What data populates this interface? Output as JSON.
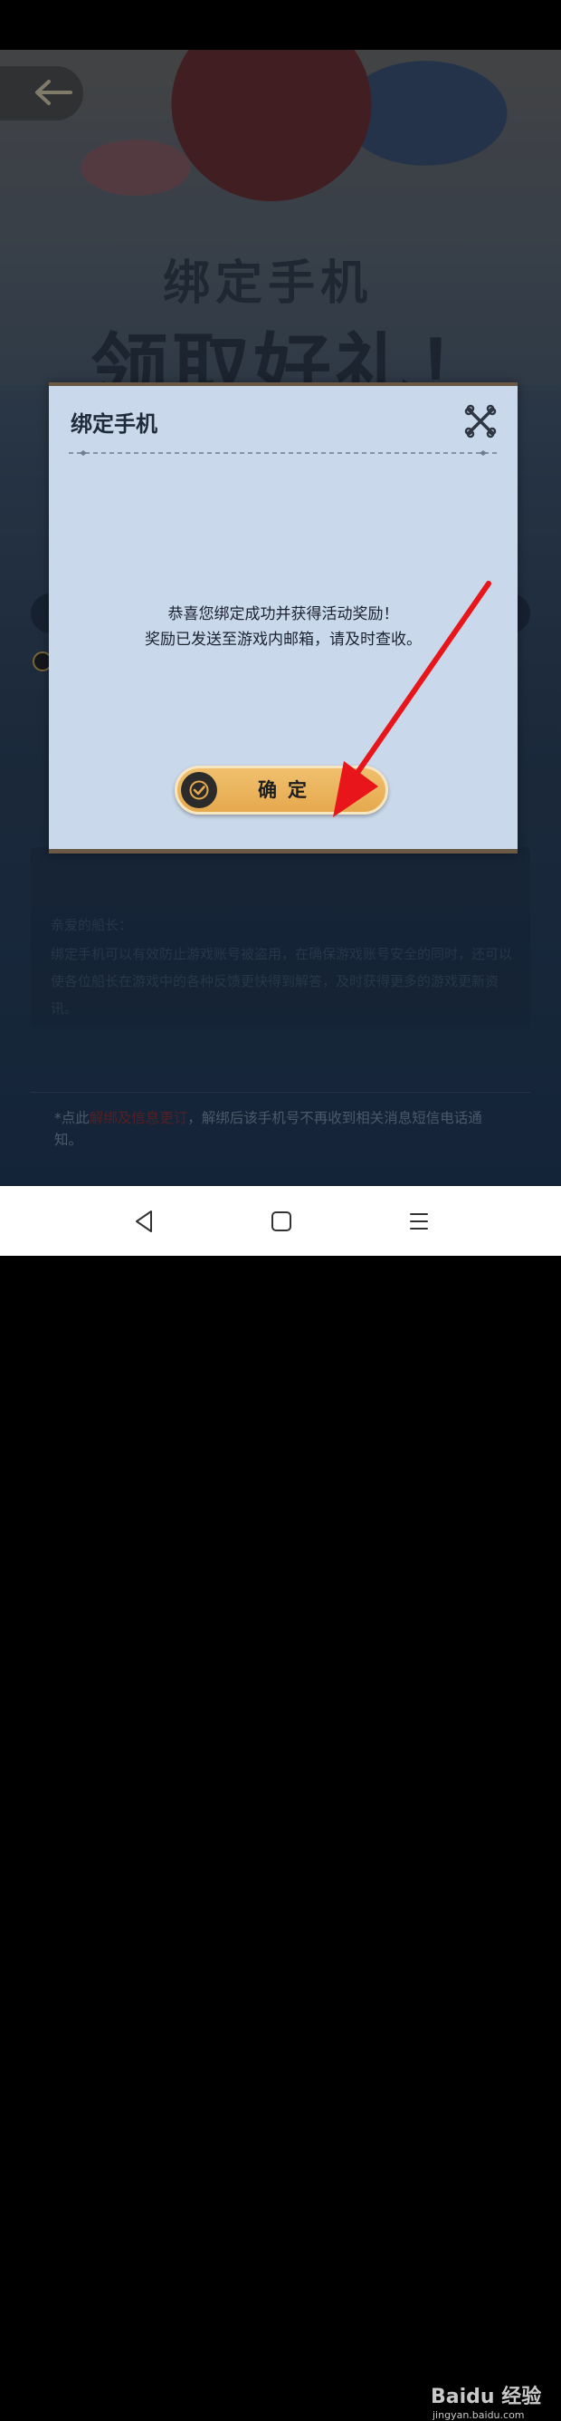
{
  "hero": {
    "title_line1": "绑定手机",
    "title_line2": "领取好礼！"
  },
  "background_page": {
    "notice_title": "亲爱的船长：",
    "notice_text": "绑定手机可以有效防止游戏账号被盗用，在确保游戏账号安全的同时，还可以使各位船长在游戏中的各种反馈更快得到解答，及时获得更多的游戏更新资讯。",
    "footer_prefix": "*点此",
    "footer_link": "解绑及信息更订",
    "footer_suffix": "，解绑后该手机号不再收到相关消息短信电话通知。"
  },
  "dialog": {
    "title": "绑定手机",
    "message_line1": "恭喜您绑定成功并获得活动奖励！",
    "message_line2": "奖励已发送至游戏内邮箱，请及时查收。",
    "confirm_label": "确定"
  },
  "watermark": {
    "brand": "Baidu 经验",
    "url": "jingyan.baidu.com"
  },
  "colors": {
    "dialog_bg": "#c9d8ea",
    "confirm_button": "#e6a94e",
    "annotation_arrow": "#e8151b"
  }
}
